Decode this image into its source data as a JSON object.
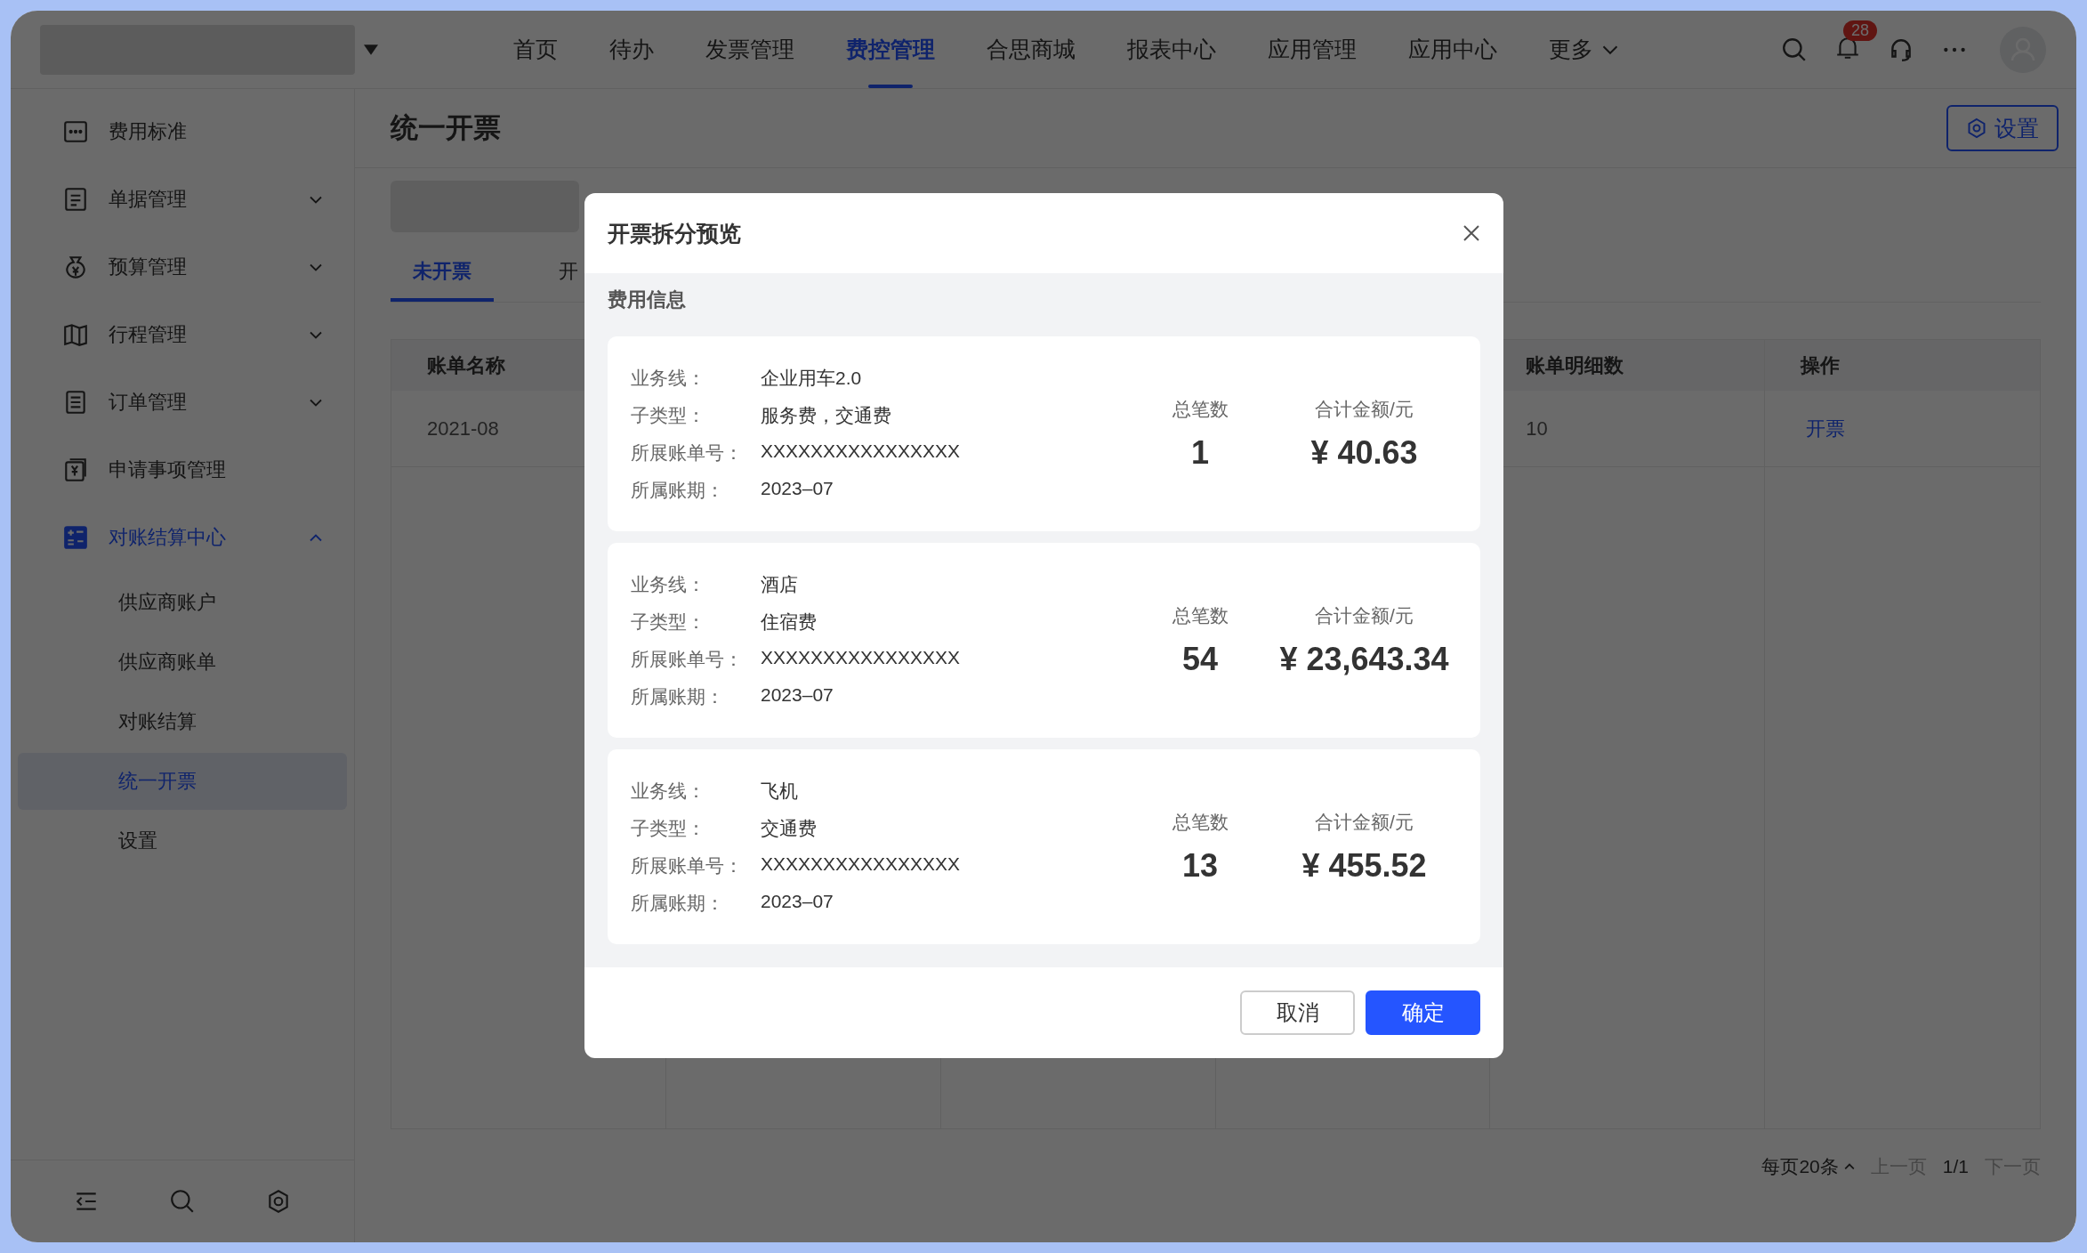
{
  "top_nav": {
    "items": [
      {
        "label": "首页",
        "selected": false
      },
      {
        "label": "待办",
        "selected": false
      },
      {
        "label": "发票管理",
        "selected": false
      },
      {
        "label": "费控管理",
        "selected": true
      },
      {
        "label": "合思商城",
        "selected": false
      },
      {
        "label": "报表中心",
        "selected": false
      },
      {
        "label": "应用管理",
        "selected": false
      },
      {
        "label": "应用中心",
        "selected": false
      },
      {
        "label": "更多",
        "selected": false,
        "kind": "dropdown"
      }
    ],
    "notification_badge": "28"
  },
  "sidebar": {
    "items": [
      {
        "label": "费用标准",
        "kind": "link",
        "selected": false
      },
      {
        "label": "单据管理",
        "kind": "group",
        "selected": false,
        "expanded": false
      },
      {
        "label": "预算管理",
        "kind": "group",
        "selected": false,
        "expanded": false
      },
      {
        "label": "行程管理",
        "kind": "group",
        "selected": false,
        "expanded": false
      },
      {
        "label": "订单管理",
        "kind": "group",
        "selected": false,
        "expanded": false
      },
      {
        "label": "申请事项管理",
        "kind": "link",
        "selected": false
      },
      {
        "label": "对账结算中心",
        "kind": "group",
        "selected": true,
        "expanded": true,
        "children": [
          {
            "label": "供应商账户",
            "selected": false
          },
          {
            "label": "供应商账单",
            "selected": false
          },
          {
            "label": "对账结算",
            "selected": false
          },
          {
            "label": "统一开票",
            "selected": true
          },
          {
            "label": "设置",
            "selected": false
          }
        ]
      }
    ]
  },
  "page": {
    "title": "统一开票",
    "settings_button": "设置",
    "tabs": [
      {
        "label": "未开票",
        "selected": true
      },
      {
        "label": "开",
        "selected": false
      }
    ],
    "table": {
      "columns": [
        "账单名称",
        "账单明细数",
        "操作"
      ],
      "rows": [
        {
          "cells": [
            "2021-08",
            "10",
            "开票"
          ]
        }
      ]
    },
    "pagination": {
      "page_size": "每页20条",
      "prev": "上一页",
      "page": "1/1",
      "next": "下一页"
    }
  },
  "modal": {
    "title": "开票拆分预览",
    "section_title": "费用信息",
    "cards": [
      {
        "fields": [
          {
            "label": "业务线：",
            "value": "企业用车2.0"
          },
          {
            "label": "子类型：",
            "value": "服务费，交通费"
          },
          {
            "label": "所展账单号：",
            "value": "XXXXXXXXXXXXXXXX"
          },
          {
            "label": "所属账期：",
            "value": "2023–07"
          }
        ],
        "count_label": "总笔数",
        "count": "1",
        "amount_label": "合计金额/元",
        "amount": "¥ 40.63"
      },
      {
        "fields": [
          {
            "label": "业务线：",
            "value": "酒店"
          },
          {
            "label": "子类型：",
            "value": "住宿费"
          },
          {
            "label": "所展账单号：",
            "value": "XXXXXXXXXXXXXXXX"
          },
          {
            "label": "所属账期：",
            "value": "2023–07"
          }
        ],
        "count_label": "总笔数",
        "count": "54",
        "amount_label": "合计金额/元",
        "amount": "¥ 23,643.34"
      },
      {
        "fields": [
          {
            "label": "业务线：",
            "value": "飞机"
          },
          {
            "label": "子类型：",
            "value": "交通费"
          },
          {
            "label": "所展账单号：",
            "value": "XXXXXXXXXXXXXXXX"
          },
          {
            "label": "所属账期：",
            "value": "2023–07"
          }
        ],
        "count_label": "总笔数",
        "count": "13",
        "amount_label": "合计金额/元",
        "amount": "¥ 455.52"
      }
    ],
    "buttons": [
      {
        "label": "取消",
        "kind": "secondary"
      },
      {
        "label": "确定",
        "kind": "primary"
      }
    ]
  }
}
